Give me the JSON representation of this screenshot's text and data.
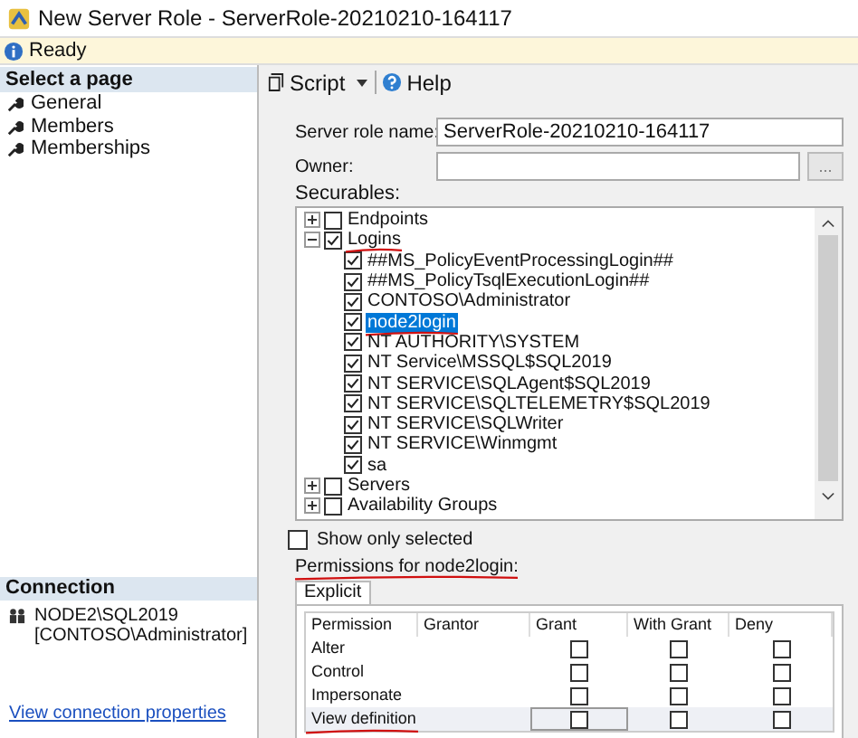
{
  "window": {
    "title": "New Server Role - ServerRole-20210210-164117"
  },
  "status": {
    "text": "Ready"
  },
  "sidebar": {
    "header": "Select a page",
    "items": [
      {
        "label": "General",
        "selected": false
      },
      {
        "label": "Members",
        "selected": false
      },
      {
        "label": "Memberships",
        "selected": false
      }
    ]
  },
  "connection": {
    "header": "Connection",
    "server": "NODE2\\SQL2019",
    "user": "[CONTOSO\\Administrator]",
    "link": "View connection properties"
  },
  "toolbar": {
    "script": "Script",
    "help": "Help"
  },
  "form": {
    "role_name_label": "Server role name:",
    "role_name": "ServerRole-20210210-164117",
    "owner_label": "Owner:",
    "browse": "...",
    "securables_label": "Securables:"
  },
  "tree": [
    {
      "label": "Endpoints",
      "checked": false,
      "expanded": false,
      "selected": false,
      "annotated": false
    },
    {
      "label": "Logins",
      "checked": true,
      "expanded": true,
      "selected": false,
      "annotated": true,
      "children": [
        {
          "label": "##MS_PolicyEventProcessingLogin##",
          "checked": true,
          "selected": false,
          "annotated": false
        },
        {
          "label": "##MS_PolicyTsqlExecutionLogin##",
          "checked": true,
          "selected": false,
          "annotated": false
        },
        {
          "label": "CONTOSO\\Administrator",
          "checked": true,
          "selected": false,
          "annotated": false
        },
        {
          "label": "node2login",
          "checked": true,
          "selected": true,
          "annotated": true
        },
        {
          "label": "NT AUTHORITY\\SYSTEM",
          "checked": true,
          "selected": false,
          "annotated": false
        },
        {
          "label": "NT Service\\MSSQL$SQL2019",
          "checked": true,
          "selected": false,
          "annotated": false
        },
        {
          "label": "NT SERVICE\\SQLAgent$SQL2019",
          "checked": true,
          "selected": false,
          "annotated": false
        },
        {
          "label": "NT SERVICE\\SQLTELEMETRY$SQL2019",
          "checked": true,
          "selected": false,
          "annotated": false
        },
        {
          "label": "NT SERVICE\\SQLWriter",
          "checked": true,
          "selected": false,
          "annotated": false
        },
        {
          "label": "NT SERVICE\\Winmgmt",
          "checked": true,
          "selected": false,
          "annotated": false
        },
        {
          "label": "sa",
          "checked": true,
          "selected": false,
          "annotated": false
        }
      ]
    },
    {
      "label": "Servers",
      "checked": false,
      "expanded": false,
      "selected": false,
      "annotated": false
    },
    {
      "label": "Availability Groups",
      "checked": false,
      "expanded": false,
      "selected": false,
      "annotated": false
    }
  ],
  "show_only_selected": {
    "label": "Show only selected",
    "checked": false
  },
  "permissions": {
    "label": "Permissions for node2login:",
    "tabs": [
      {
        "label": "Explicit",
        "selected": true
      }
    ],
    "columns": [
      "Permission",
      "Grantor",
      "Grant",
      "With Grant",
      "Deny"
    ],
    "rows": [
      {
        "permission": "Alter",
        "grant": false,
        "with_grant": false,
        "deny": false,
        "selected": false
      },
      {
        "permission": "Control",
        "grant": false,
        "with_grant": false,
        "deny": false,
        "selected": false
      },
      {
        "permission": "Impersonate",
        "grant": false,
        "with_grant": false,
        "deny": false,
        "selected": false
      },
      {
        "permission": "View definition",
        "grant": false,
        "with_grant": false,
        "deny": false,
        "selected": true
      }
    ]
  }
}
